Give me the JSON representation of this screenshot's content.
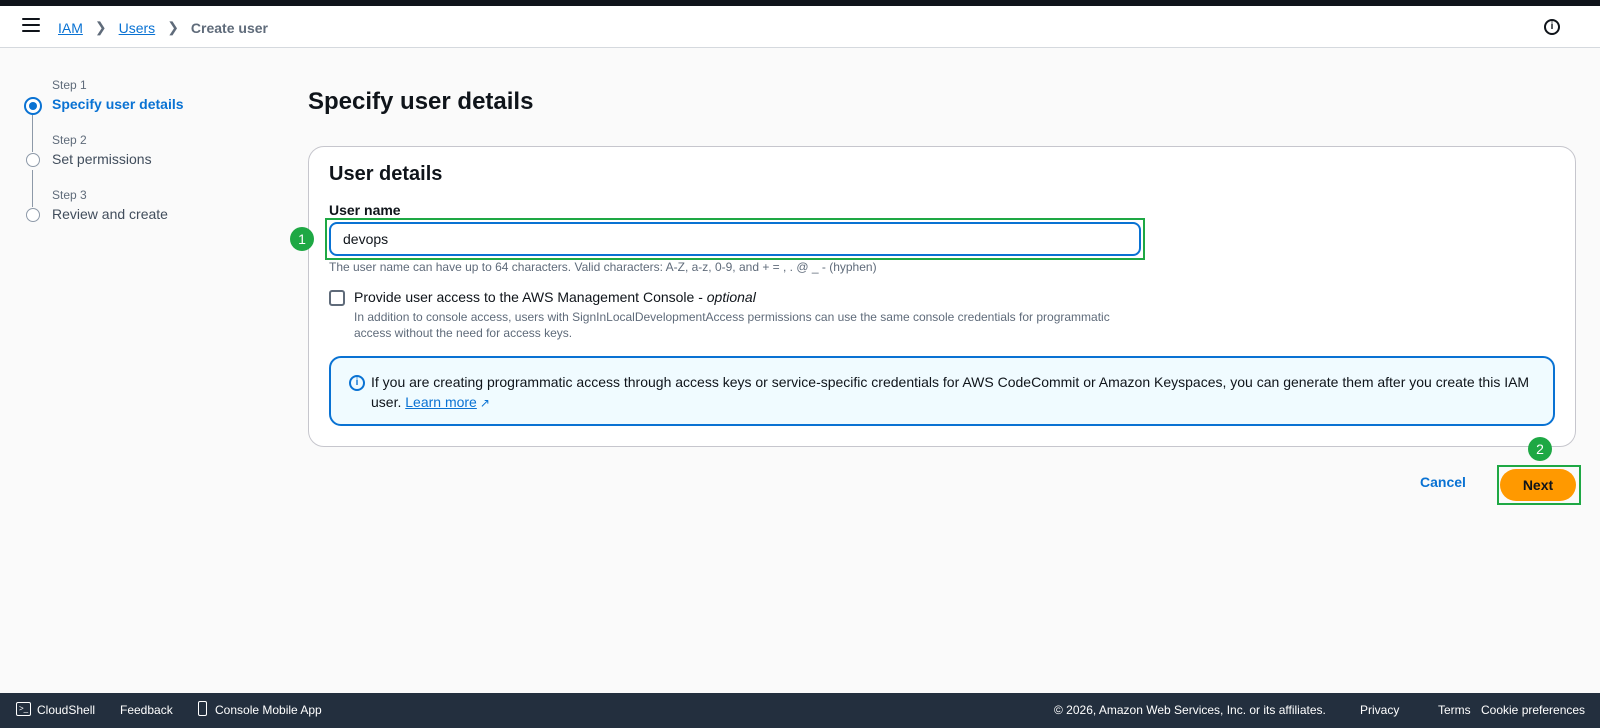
{
  "header": {
    "breadcrumbs": [
      "IAM",
      "Users"
    ],
    "current": "Create user"
  },
  "steps": [
    {
      "label": "Step 1",
      "title": "Specify user details"
    },
    {
      "label": "Step 2",
      "title": "Set permissions"
    },
    {
      "label": "Step 3",
      "title": "Review and create"
    }
  ],
  "page_title": "Specify user details",
  "user_details": {
    "title": "User details",
    "username_label": "User name",
    "username_value": "devops",
    "constraint": "The user name can have up to 64 characters. Valid characters: A-Z, a-z, 0-9, and + = , . @ _ - (hyphen)",
    "console_access_label": "Provide user access to the AWS Management Console - ",
    "console_access_optional": "optional",
    "console_access_desc": "In addition to console access, users with SignInLocalDevelopmentAccess permissions can use the same console credentials for programmatic access without the need for access keys."
  },
  "alert": {
    "text": "If you are creating programmatic access through access keys or service-specific credentials for AWS CodeCommit or Amazon Keyspaces, you can generate them after you create this IAM user. ",
    "link": "Learn more"
  },
  "markers": [
    "1",
    "2"
  ],
  "actions": {
    "cancel": "Cancel",
    "next": "Next"
  },
  "footer": {
    "cloudshell": "CloudShell",
    "feedback": "Feedback",
    "mobile_app": "Console Mobile App",
    "copyright": "© 2026, Amazon Web Services, Inc. or its affiliates.",
    "privacy": "Privacy",
    "terms": "Terms",
    "cookies": "Cookie preferences"
  },
  "colors": {
    "accent": "#0972d3",
    "primary_button": "#ff9900",
    "highlight": "#1ea844"
  }
}
